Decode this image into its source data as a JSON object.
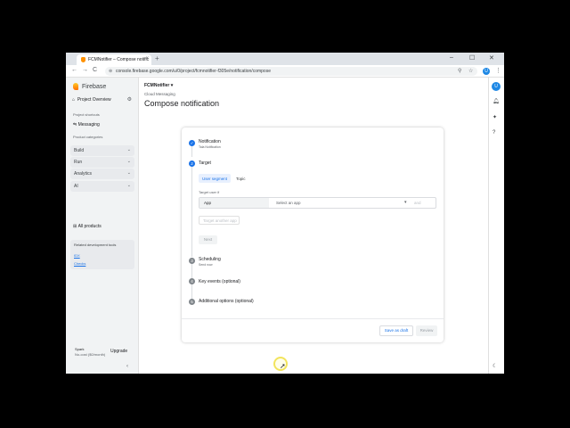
{
  "browser": {
    "tab_title": "FCMNotifier – Compose notific",
    "tab_close": "×",
    "new_tab": "+",
    "url": "console.firebase.google.com/u/0/project/fcmnotifier-f305e/notification/compose",
    "profile_initial": "U",
    "window_controls": [
      "–",
      "☐",
      "✕"
    ],
    "nav": [
      "←",
      "→",
      "C"
    ]
  },
  "sidebar": {
    "brand": "Firebase",
    "project_overview": "Project Overview",
    "project_shortcuts": "Project shortcuts",
    "messaging": "Messaging",
    "product_categories": "Product categories",
    "categories": [
      "Build",
      "Run",
      "Analytics",
      "AI"
    ],
    "all_products": "All products",
    "related_title": "Related development tools",
    "related_links": [
      "IDX",
      "Checks"
    ],
    "plan_name": "Spark",
    "plan_sub": "No-cost ($0/month)",
    "upgrade": "Upgrade",
    "collapse": "‹"
  },
  "header": {
    "project": "FCMNotifier ▾",
    "breadcrumb": "Cloud Messaging",
    "title": "Compose notification"
  },
  "card": {
    "steps": [
      {
        "num": "✓",
        "title": "Notification",
        "sub": "Tala Notification"
      },
      {
        "num": "2",
        "title": "Target",
        "sub": ""
      },
      {
        "num": "3",
        "title": "Scheduling",
        "sub": "Send now"
      },
      {
        "num": "4",
        "title": "Key events (optional)",
        "sub": ""
      },
      {
        "num": "5",
        "title": "Additional options (optional)",
        "sub": ""
      }
    ],
    "segments": [
      "User segment",
      "Topic"
    ],
    "target_label": "Target user if",
    "row": {
      "app": "App",
      "select": "Select an app",
      "and": "and"
    },
    "target_another": "Target another app",
    "next": "Next",
    "save_draft": "Save as draft",
    "review": "Review"
  },
  "colors": {
    "accent": "#1a73e8",
    "step_active": "#1a73e8",
    "step_inactive": "#80868b"
  },
  "icons": [
    "search-icon",
    "star-icon",
    "bell-icon",
    "sparkle-icon",
    "help-icon",
    "dark-mode-icon",
    "gear-icon",
    "home-icon"
  ]
}
